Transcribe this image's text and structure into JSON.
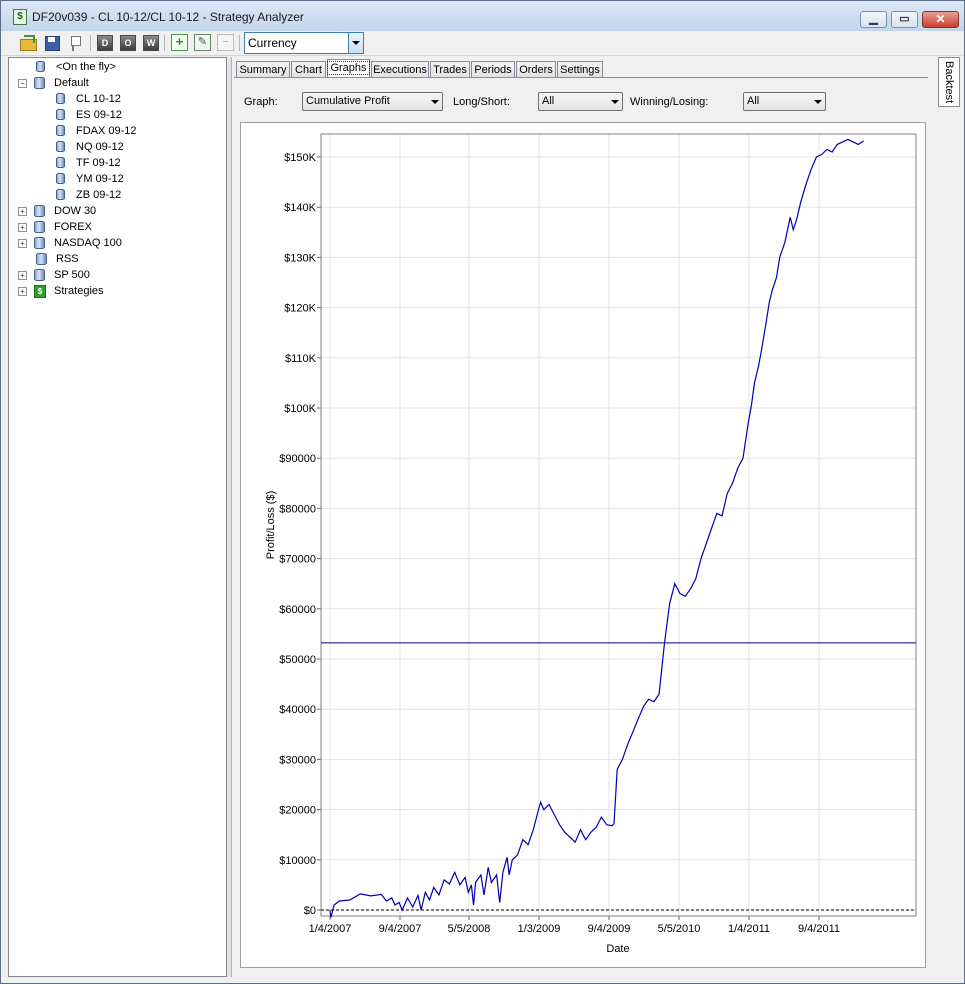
{
  "window": {
    "title": "DF20v039 - CL 10-12/CL 10-12 - Strategy Analyzer",
    "app_icon": "strategy-analyzer-icon",
    "controls": [
      "minimize-icon",
      "maximize-icon",
      "close-icon"
    ]
  },
  "toolbar": {
    "display_unit": "Currency",
    "letter_buttons": [
      "D",
      "O",
      "W"
    ]
  },
  "tree": {
    "items": [
      {
        "label": "<On the fly>",
        "level": 1,
        "expander": "",
        "icon": "database-icon"
      },
      {
        "label": "Default",
        "level": 0,
        "expander": "−",
        "icon": "database-group-icon"
      },
      {
        "label": "CL 10-12",
        "level": 2,
        "expander": "",
        "icon": "database-icon"
      },
      {
        "label": "ES 09-12",
        "level": 2,
        "expander": "",
        "icon": "database-icon"
      },
      {
        "label": "FDAX 09-12",
        "level": 2,
        "expander": "",
        "icon": "database-icon"
      },
      {
        "label": "NQ 09-12",
        "level": 2,
        "expander": "",
        "icon": "database-icon"
      },
      {
        "label": "TF 09-12",
        "level": 2,
        "expander": "",
        "icon": "database-icon"
      },
      {
        "label": "YM 09-12",
        "level": 2,
        "expander": "",
        "icon": "database-icon"
      },
      {
        "label": "ZB 09-12",
        "level": 2,
        "expander": "",
        "icon": "database-icon"
      },
      {
        "label": "DOW 30",
        "level": 0,
        "expander": "+",
        "icon": "database-group-icon"
      },
      {
        "label": "FOREX",
        "level": 0,
        "expander": "+",
        "icon": "database-group-icon"
      },
      {
        "label": "NASDAQ 100",
        "level": 0,
        "expander": "+",
        "icon": "database-group-icon"
      },
      {
        "label": "RSS",
        "level": 1,
        "expander": "",
        "icon": "database-group-icon"
      },
      {
        "label": "SP 500",
        "level": 0,
        "expander": "+",
        "icon": "database-group-icon"
      },
      {
        "label": "Strategies",
        "level": 0,
        "expander": "+",
        "icon": "strategy-icon"
      }
    ]
  },
  "tabs": [
    "Summary",
    "Chart",
    "Graphs",
    "Executions",
    "Trades",
    "Periods",
    "Orders",
    "Settings"
  ],
  "active_tab": "Graphs",
  "options": {
    "graph_label": "Graph:",
    "graph_value": "Cumulative Profit",
    "longshort_label": "Long/Short:",
    "longshort_value": "All",
    "winlose_label": "Winning/Losing:",
    "winlose_value": "All"
  },
  "side_tab": "Backtest",
  "colors": {
    "series": "#0000b4",
    "reference_line": "#00007a",
    "grid": "#e3e3e3"
  },
  "chart_data": {
    "type": "line",
    "title": "",
    "xlabel": "Date",
    "ylabel": "Profit/Loss ($)",
    "x_tick_labels": [
      "1/4/2007",
      "9/4/2007",
      "5/5/2008",
      "1/3/2009",
      "9/4/2009",
      "5/5/2010",
      "1/4/2011",
      "9/4/2011"
    ],
    "y_tick_labels": [
      "$0",
      "$10000",
      "$20000",
      "$30000",
      "$40000",
      "$50000",
      "$60000",
      "$70000",
      "$80000",
      "$90000",
      "$100K",
      "$110K",
      "$120K",
      "$130K",
      "$140K",
      "$150K"
    ],
    "ylim": [
      -2000,
      155000
    ],
    "grid": true,
    "reference_line": 53200,
    "zero_line": 0,
    "series": [
      {
        "values": [
          [
            2007.01,
            0
          ],
          [
            2007.02,
            -1500
          ],
          [
            2007.05,
            1000
          ],
          [
            2007.1,
            1800
          ],
          [
            2007.2,
            2000
          ],
          [
            2007.3,
            3200
          ],
          [
            2007.4,
            2800
          ],
          [
            2007.5,
            3100
          ],
          [
            2007.55,
            1800
          ],
          [
            2007.6,
            2400
          ],
          [
            2007.63,
            1000
          ],
          [
            2007.67,
            1500
          ],
          [
            2007.7,
            0
          ],
          [
            2007.75,
            2400
          ],
          [
            2007.8,
            600
          ],
          [
            2007.85,
            2900
          ],
          [
            2007.88,
            0
          ],
          [
            2007.92,
            3500
          ],
          [
            2007.96,
            2000
          ],
          [
            2008.0,
            4500
          ],
          [
            2008.05,
            3000
          ],
          [
            2008.1,
            6000
          ],
          [
            2008.15,
            5200
          ],
          [
            2008.2,
            7500
          ],
          [
            2008.25,
            5000
          ],
          [
            2008.3,
            6500
          ],
          [
            2008.33,
            3500
          ],
          [
            2008.36,
            5000
          ],
          [
            2008.38,
            1000
          ],
          [
            2008.4,
            5500
          ],
          [
            2008.45,
            7000
          ],
          [
            2008.48,
            3000
          ],
          [
            2008.52,
            8500
          ],
          [
            2008.55,
            5500
          ],
          [
            2008.6,
            7000
          ],
          [
            2008.63,
            1500
          ],
          [
            2008.66,
            7500
          ],
          [
            2008.7,
            10500
          ],
          [
            2008.72,
            7000
          ],
          [
            2008.75,
            10000
          ],
          [
            2008.8,
            11000
          ],
          [
            2008.85,
            14000
          ],
          [
            2008.9,
            13000
          ],
          [
            2008.95,
            16000
          ],
          [
            2009.0,
            20000
          ],
          [
            2009.02,
            21500
          ],
          [
            2009.05,
            20000
          ],
          [
            2009.1,
            21000
          ],
          [
            2009.15,
            19000
          ],
          [
            2009.2,
            17000
          ],
          [
            2009.25,
            15500
          ],
          [
            2009.3,
            14500
          ],
          [
            2009.35,
            13500
          ],
          [
            2009.4,
            16000
          ],
          [
            2009.45,
            14000
          ],
          [
            2009.5,
            15500
          ],
          [
            2009.55,
            16500
          ],
          [
            2009.6,
            18500
          ],
          [
            2009.65,
            17000
          ],
          [
            2009.7,
            16800
          ],
          [
            2009.72,
            17200
          ],
          [
            2009.75,
            28000
          ],
          [
            2009.8,
            30000
          ],
          [
            2009.85,
            33000
          ],
          [
            2009.9,
            35500
          ],
          [
            2009.95,
            38000
          ],
          [
            2010.0,
            40500
          ],
          [
            2010.05,
            42000
          ],
          [
            2010.1,
            41500
          ],
          [
            2010.15,
            43000
          ],
          [
            2010.2,
            53000
          ],
          [
            2010.25,
            61000
          ],
          [
            2010.3,
            65000
          ],
          [
            2010.35,
            63000
          ],
          [
            2010.4,
            62500
          ],
          [
            2010.45,
            64000
          ],
          [
            2010.5,
            66000
          ],
          [
            2010.55,
            70000
          ],
          [
            2010.6,
            73000
          ],
          [
            2010.65,
            76000
          ],
          [
            2010.7,
            79000
          ],
          [
            2010.75,
            78500
          ],
          [
            2010.8,
            83000
          ],
          [
            2010.85,
            85000
          ],
          [
            2010.9,
            88000
          ],
          [
            2010.95,
            90000
          ],
          [
            2011.0,
            97000
          ],
          [
            2011.03,
            100500
          ],
          [
            2011.06,
            105000
          ],
          [
            2011.1,
            108500
          ],
          [
            2011.13,
            112000
          ],
          [
            2011.17,
            117000
          ],
          [
            2011.2,
            121000
          ],
          [
            2011.23,
            123500
          ],
          [
            2011.27,
            126000
          ],
          [
            2011.3,
            130000
          ],
          [
            2011.35,
            133000
          ],
          [
            2011.4,
            138000
          ],
          [
            2011.43,
            135500
          ],
          [
            2011.46,
            137500
          ],
          [
            2011.5,
            141000
          ],
          [
            2011.55,
            144500
          ],
          [
            2011.6,
            147500
          ],
          [
            2011.65,
            150000
          ],
          [
            2011.7,
            150500
          ],
          [
            2011.75,
            151500
          ],
          [
            2011.8,
            151000
          ],
          [
            2011.85,
            152500
          ],
          [
            2011.9,
            153000
          ],
          [
            2011.95,
            153500
          ],
          [
            2012.0,
            153000
          ],
          [
            2012.05,
            152500
          ],
          [
            2012.1,
            153200
          ]
        ]
      }
    ]
  }
}
